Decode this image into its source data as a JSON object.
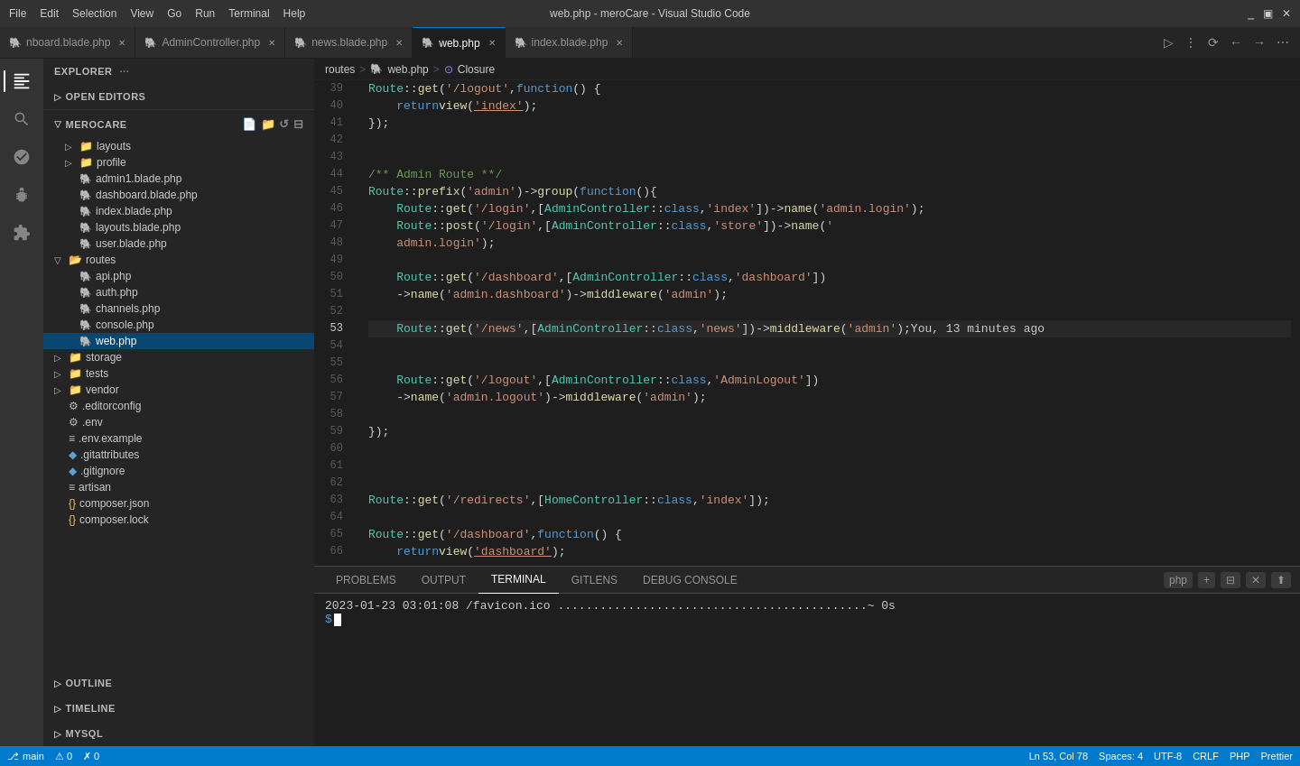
{
  "titlebar": {
    "menu_items": [
      "File",
      "Edit",
      "Selection",
      "View",
      "Go",
      "Run",
      "Terminal",
      "Help"
    ],
    "title": "web.php - meroCare - Visual Studio Code",
    "controls": [
      "⬜",
      "❐",
      "✕"
    ]
  },
  "tabs": [
    {
      "id": "dashboard",
      "label": "nboard.blade.php",
      "icon": "php",
      "active": false,
      "modified": false
    },
    {
      "id": "admin",
      "label": "AdminController.php",
      "icon": "php",
      "active": false,
      "modified": false
    },
    {
      "id": "news",
      "label": "news.blade.php",
      "icon": "php",
      "active": false,
      "modified": false
    },
    {
      "id": "web",
      "label": "web.php",
      "icon": "php",
      "active": true,
      "modified": false
    },
    {
      "id": "index",
      "label": "index.blade.php",
      "icon": "php",
      "active": false,
      "modified": false
    }
  ],
  "breadcrumb": {
    "parts": [
      "routes",
      ">",
      "web.php",
      ">",
      "Closure"
    ]
  },
  "sidebar": {
    "explorer_label": "EXPLORER",
    "open_editors_label": "OPEN EDITORS",
    "project_label": "MEROCARE",
    "items": [
      {
        "name": "layouts",
        "type": "folder",
        "indent": 1
      },
      {
        "name": "profile",
        "type": "folder",
        "indent": 1
      },
      {
        "name": "admin1.blade.php",
        "type": "php",
        "indent": 1
      },
      {
        "name": "dashboard.blade.php",
        "type": "php",
        "indent": 1
      },
      {
        "name": "index.blade.php",
        "type": "php",
        "indent": 1
      },
      {
        "name": "layouts.blade.php",
        "type": "php",
        "indent": 1
      },
      {
        "name": "user.blade.php",
        "type": "php",
        "indent": 1
      },
      {
        "name": "routes",
        "type": "folder",
        "indent": 0
      },
      {
        "name": "api.php",
        "type": "php",
        "indent": 1
      },
      {
        "name": "auth.php",
        "type": "php",
        "indent": 1
      },
      {
        "name": "channels.php",
        "type": "php",
        "indent": 1
      },
      {
        "name": "console.php",
        "type": "php",
        "indent": 1
      },
      {
        "name": "web.php",
        "type": "php",
        "indent": 1,
        "active": true
      },
      {
        "name": "storage",
        "type": "folder",
        "indent": 0
      },
      {
        "name": "tests",
        "type": "folder",
        "indent": 0
      },
      {
        "name": "vendor",
        "type": "folder",
        "indent": 0
      },
      {
        "name": ".editorconfig",
        "type": "gear",
        "indent": 0
      },
      {
        "name": ".env",
        "type": "gear",
        "indent": 0
      },
      {
        "name": ".env.example",
        "type": "list",
        "indent": 0
      },
      {
        "name": ".gitattributes",
        "type": "diamond",
        "indent": 0
      },
      {
        "name": ".gitignore",
        "type": "diamond",
        "indent": 0
      },
      {
        "name": "artisan",
        "type": "list",
        "indent": 0
      },
      {
        "name": "composer.json",
        "type": "json",
        "indent": 0
      },
      {
        "name": "composer.lock",
        "type": "json",
        "indent": 0
      }
    ]
  },
  "bottom_sections": [
    {
      "name": "OUTLINE",
      "collapsed": true
    },
    {
      "name": "TIMELINE",
      "collapsed": true
    },
    {
      "name": "MYSQL",
      "collapsed": true
    }
  ],
  "code_lines": [
    {
      "num": 39,
      "content": "Route::get('/logout', function () {"
    },
    {
      "num": 40,
      "content": "    return view('index');"
    },
    {
      "num": 41,
      "content": "});"
    },
    {
      "num": 42,
      "content": ""
    },
    {
      "num": 43,
      "content": ""
    },
    {
      "num": 44,
      "content": "/** Admin Route **/"
    },
    {
      "num": 45,
      "content": "Route::prefix('admin')->group(function (){"
    },
    {
      "num": 46,
      "content": "    Route::get('/login',[AdminController::class,'index'])->name('admin.login');"
    },
    {
      "num": 47,
      "content": "    Route::post('/login',[AdminController::class,'store'])->name('"
    },
    {
      "num": 48,
      "content": "    admin.login');"
    },
    {
      "num": 49,
      "content": ""
    },
    {
      "num": 50,
      "content": "    Route::get('/dashboard',[AdminController::class,'dashboard'])"
    },
    {
      "num": 51,
      "content": "    ->name('admin.dashboard')->middleware('admin');"
    },
    {
      "num": 52,
      "content": ""
    },
    {
      "num": 53,
      "content": "    Route::get('/news',[AdminController::class,'news'])->middleware('admin');",
      "git": "You, 13 minutes ago",
      "active": true
    },
    {
      "num": 54,
      "content": ""
    },
    {
      "num": 55,
      "content": ""
    },
    {
      "num": 56,
      "content": "    Route::get('/logout',[AdminController::class,'AdminLogout'])"
    },
    {
      "num": 57,
      "content": "    ->name('admin.logout')->middleware('admin');"
    },
    {
      "num": 58,
      "content": ""
    },
    {
      "num": 59,
      "content": "});"
    },
    {
      "num": 60,
      "content": ""
    },
    {
      "num": 61,
      "content": ""
    },
    {
      "num": 62,
      "content": ""
    },
    {
      "num": 63,
      "content": "Route::get('/redirects',[HomeController::class,'index']);"
    },
    {
      "num": 64,
      "content": ""
    },
    {
      "num": 65,
      "content": "Route::get('/dashboard', function () {"
    },
    {
      "num": 66,
      "content": "    return view('dashboard');"
    }
  ],
  "terminal": {
    "tabs": [
      "PROBLEMS",
      "OUTPUT",
      "TERMINAL",
      "GITLENS",
      "DEBUG CONSOLE"
    ],
    "active_tab": "TERMINAL",
    "content": "2023-01-23  03:01:08 /favicon.ico ............................................~ 0s",
    "shell_label": "php",
    "prompt": "$"
  },
  "statusbar": {
    "left_items": [
      "⎇ main",
      "⚠ 0",
      "✗ 0"
    ],
    "right_items": [
      "Ln 53, Col 78",
      "Spaces: 4",
      "UTF-8",
      "CRLF",
      "PHP",
      "Prettier"
    ]
  }
}
